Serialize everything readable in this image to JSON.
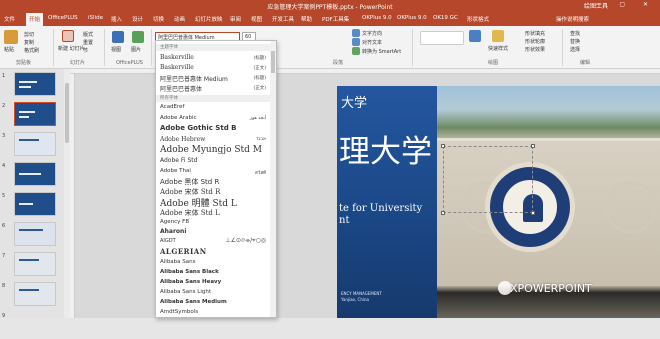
{
  "window": {
    "title": "应急管理大学案例PPT模板.pptx  -  PowerPoint",
    "context_tab": "绘图工具",
    "controls": "— ▢ ✕"
  },
  "tabs": [
    {
      "label": "文件"
    },
    {
      "label": "开始"
    },
    {
      "label": "OfficePLUS"
    },
    {
      "label": "iSlide"
    },
    {
      "label": "插入"
    },
    {
      "label": "设计"
    },
    {
      "label": "切换"
    },
    {
      "label": "动画"
    },
    {
      "label": "幻灯片放映"
    },
    {
      "label": "审阅"
    },
    {
      "label": "视图"
    },
    {
      "label": "开发工具"
    },
    {
      "label": "帮助"
    },
    {
      "label": "PDF工具集"
    },
    {
      "label": "OKPlus 9.0"
    },
    {
      "label": "OKPlus 9.0"
    },
    {
      "label": "OK19 GC"
    },
    {
      "label": "形状格式"
    },
    {
      "label": "操作说明搜索"
    }
  ],
  "ribbon": {
    "paste": "粘贴",
    "cut": "剪切",
    "copy": "复制",
    "format_painter": "格式刷",
    "clipboard_group": "剪贴板",
    "new_slide": "新建\n幻灯片",
    "layout": "版式",
    "reset": "重置",
    "section": "节",
    "slides_group": "幻灯片",
    "officeplus_1": "视图",
    "officeplus_2": "图片",
    "officeplus_group": "OfficePLUS",
    "font_value": "阿里巴巴普惠体 Medium",
    "font_size": "60",
    "text_direction": "文字方向",
    "align_text": "对齐文本",
    "smartart": "转换为 SmartArt",
    "paragraph_group": "段落",
    "quick_styles": "快速样式",
    "drawing_group": "绘图",
    "fill": "形状填充",
    "outline": "形状轮廓",
    "effects": "形状效果",
    "find": "查找",
    "replace": "替换",
    "select": "选择",
    "editing_group": "编辑"
  },
  "font_dropdown": {
    "theme_header": "主题字体",
    "theme_fonts": [
      {
        "name": "Baskerville",
        "tag": "(标题)"
      },
      {
        "name": "Baskerville",
        "tag": "(正文)"
      },
      {
        "name": "阿里巴巴普惠体 Medium",
        "tag": "(标题)"
      },
      {
        "name": "阿里巴巴普惠体",
        "tag": "(正文)"
      }
    ],
    "all_header": "所有字体",
    "fonts": [
      {
        "name": "AcadEref",
        "style": "normal"
      },
      {
        "name": "Adobe Arabic",
        "style": "normal",
        "sample": "أبجد هوز"
      },
      {
        "name": "Adobe Gothic Std B",
        "style": "bold"
      },
      {
        "name": "Adobe Hebrew",
        "style": "normal",
        "sample": "אבגד"
      },
      {
        "name": "Adobe Myungjo Std M",
        "style": "big"
      },
      {
        "name": "Adobe Fi Std",
        "style": "normal"
      },
      {
        "name": "Adobe Thai",
        "style": "normal",
        "sample": "สวัสดี"
      },
      {
        "name": "Adobe 黑体 Std R",
        "style": "med"
      },
      {
        "name": "Adobe 宋体 Std R",
        "style": "med"
      },
      {
        "name": "Adobe 明體 Std L",
        "style": "big"
      },
      {
        "name": "Adobe 宋体 Std L",
        "style": "med"
      },
      {
        "name": "Agency FB",
        "style": "normal"
      },
      {
        "name": "Aharoni",
        "style": "bold"
      },
      {
        "name": "AIGDT",
        "style": "normal",
        "sample": "⊥∠⊙⌭⌯/⌖○◎"
      },
      {
        "name": "ALGERIAN",
        "style": "algerian"
      },
      {
        "name": "Alibaba Sans",
        "style": "normal"
      },
      {
        "name": "Alibaba Sans Black",
        "style": "bold"
      },
      {
        "name": "Alibaba Sans Heavy",
        "style": "bold"
      },
      {
        "name": "Alibaba Sans Light",
        "style": "normal"
      },
      {
        "name": "Alibaba Sans Medium",
        "style": "semibold"
      },
      {
        "name": "AmdtSymbols",
        "style": "normal"
      }
    ]
  },
  "slide_numbers": [
    "1",
    "2",
    "3",
    "4",
    "5",
    "6",
    "7",
    "8",
    "9"
  ],
  "slide": {
    "title_small": "大学",
    "title_big": "理大学",
    "subtitle_1": "te for University",
    "subtitle_2": "nt",
    "footer_1": "ENCY MANAGEMENT",
    "footer_2": "Yanjiao, China"
  },
  "watermark": "XPOWERPOINT",
  "colors": {
    "accent": "#b7472a",
    "slide_blue": "#1f4e8a",
    "selection": "#d34a24"
  }
}
